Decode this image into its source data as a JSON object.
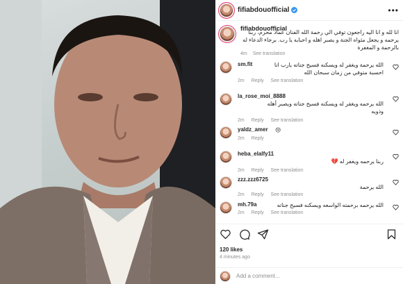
{
  "post": {
    "username": "fifiabdouofficial",
    "caption": "انا لله و انا اليه راجعون توفي الي رحمة الله الفنان عماد محرم، ربنا يرحمه و يجعل مثواه الجنة و يصبر اهله و احبابه يا رب. برجاء الدعاء له بالرحمة و المغفرة",
    "caption_time": "4m",
    "see_translation": "See translation",
    "likes": "120 likes",
    "time_ago": "4 minutes ago",
    "comment_placeholder": "Add a comment..."
  },
  "comments": [
    {
      "user": "sm.fit",
      "text": "الله يرحمة ويغفر له ويسكنه فسيح جناته يارب انا احسبة متوفي من زمان سبحان الله",
      "time": "2m",
      "reply": "Reply",
      "see_translation": "See translation"
    },
    {
      "user": "la_rose_moi_8888",
      "text": "الله يرحمه ويغفر له ويسكنه فسيح جناته ويصبر أهله وذويه",
      "time": "2m",
      "reply": "Reply",
      "see_translation": "See translation"
    },
    {
      "user": "yaldz_amer",
      "text": "😢",
      "time": "2m",
      "reply": "Reply",
      "see_translation": ""
    },
    {
      "user": "heba_elalfy11",
      "text": "ربنا يرحمه ويغفر له 💔",
      "time": "2m",
      "reply": "Reply",
      "see_translation": "See translation"
    },
    {
      "user": "zzz.zzz6725",
      "text": "الله يرحمة",
      "time": "2m",
      "reply": "Reply",
      "see_translation": "See translation"
    },
    {
      "user": "mh.79a",
      "text": "الله يرحمه برحمته الواسعه ويسكنه فسيح جناته",
      "time": "2m",
      "reply": "Reply",
      "see_translation": "See translation"
    }
  ],
  "icons": {
    "verified": "verified-badge-icon",
    "more": "more-options-icon",
    "like": "heart-icon",
    "comment": "comment-icon",
    "share": "share-icon",
    "save": "bookmark-icon"
  },
  "colors": {
    "verified": "#3897f0",
    "muted": "#8e8e8e",
    "story_ring": "#e1306c"
  }
}
